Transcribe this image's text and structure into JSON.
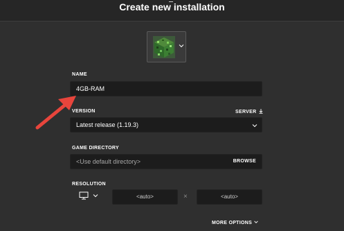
{
  "header": {
    "title": "Create new installation"
  },
  "icon_picker": {
    "icon": "grass-block-icon",
    "chevron": "chevron-down-icon"
  },
  "form": {
    "name": {
      "label": "NAME",
      "value": "4GB-RAM"
    },
    "version": {
      "label": "VERSION",
      "value": "Latest release (1.19.3)",
      "server_label": "SERVER"
    },
    "game_directory": {
      "label": "GAME DIRECTORY",
      "placeholder": "<Use default directory>",
      "browse_label": "BROWSE"
    },
    "resolution": {
      "label": "RESOLUTION",
      "width": "<auto>",
      "height": "<auto>",
      "separator": "×"
    }
  },
  "footer": {
    "more_options_label": "MORE OPTIONS"
  },
  "colors": {
    "background": "#2f2f2f",
    "field": "#1c1c1c",
    "annotation_arrow": "#e8453c"
  }
}
